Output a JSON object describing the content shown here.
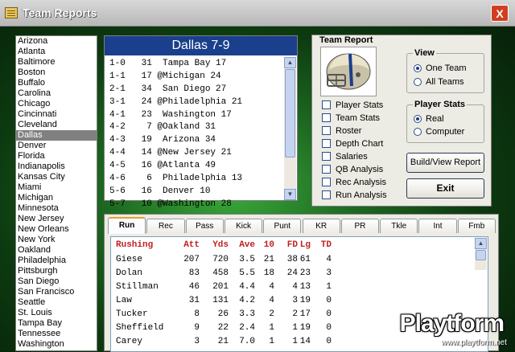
{
  "window": {
    "title": "Team Reports",
    "close_label": "X"
  },
  "teams": [
    "Arizona",
    "Atlanta",
    "Baltimore",
    "Boston",
    "Buffalo",
    "Carolina",
    "Chicago",
    "Cincinnati",
    "Cleveland",
    "Dallas",
    "Denver",
    "Florida",
    "Indianapolis",
    "Kansas City",
    "Miami",
    "Michigan",
    "Minnesota",
    "New Jersey",
    "New Orleans",
    "New York",
    "Oakland",
    "Philadelphia",
    "Pittsburgh",
    "San Diego",
    "San Francisco",
    "Seattle",
    "St. Louis",
    "Tampa Bay",
    "Tennessee",
    "Washington"
  ],
  "selected_team": "Dallas",
  "schedule": {
    "header": "Dallas 7-9",
    "games": [
      "1-0   31  Tampa Bay 17",
      "1-1   17 @Michigan 24",
      "2-1   34  San Diego 27",
      "3-1   24 @Philadelphia 21",
      "4-1   23  Washington 17",
      "4-2    7 @Oakland 31",
      "4-3   19  Arizona 34",
      "4-4   14 @New Jersey 21",
      "4-5   16 @Atlanta 49",
      "4-6    6  Philadelphia 13",
      "5-6   16  Denver 10",
      "5-7   10 @Washington 28"
    ]
  },
  "report": {
    "title": "Team Report",
    "checkboxes": [
      "Player Stats",
      "Team Stats",
      "Roster",
      "Depth Chart",
      "Salaries",
      "QB Analysis",
      "Rec Analysis",
      "Run Analysis"
    ],
    "view": {
      "label": "View",
      "options": [
        "One Team",
        "All Teams"
      ],
      "selected": "One Team"
    },
    "player_stats": {
      "label": "Player Stats",
      "options": [
        "Real",
        "Computer"
      ],
      "selected": "Real"
    },
    "build_button": "Build/View Report",
    "exit_button": "Exit"
  },
  "stats": {
    "tabs": [
      "Run",
      "Rec",
      "Pass",
      "Kick",
      "Punt",
      "KR",
      "PR",
      "Tkle",
      "Int",
      "Fmb"
    ],
    "active_tab": "Run",
    "columns": [
      "Rushing",
      "Att",
      "Yds",
      "Ave",
      "10",
      "FD",
      "Lg",
      "TD"
    ],
    "rows": [
      [
        "Giese",
        "207",
        "720",
        "3.5",
        "21",
        "38",
        "61",
        "4"
      ],
      [
        "Dolan",
        "83",
        "458",
        "5.5",
        "18",
        "24",
        "23",
        "3"
      ],
      [
        "Stillman",
        "46",
        "201",
        "4.4",
        "4",
        "4",
        "13",
        "1"
      ],
      [
        "Law",
        "31",
        "131",
        "4.2",
        "4",
        "3",
        "19",
        "0"
      ],
      [
        "Tucker",
        "8",
        "26",
        "3.3",
        "2",
        "2",
        "17",
        "0"
      ],
      [
        "Sheffield",
        "9",
        "22",
        "2.4",
        "1",
        "1",
        "19",
        "0"
      ],
      [
        "Carey",
        "3",
        "21",
        "7.0",
        "1",
        "1",
        "14",
        "0"
      ]
    ]
  },
  "watermark": {
    "brand": "Playtform",
    "url": "www.playtform.net"
  },
  "colors": {
    "header_blue": "#1a3f8c",
    "stats_header_red": "#c02020",
    "selection_gray": "#808080",
    "background_green": "#1f6a22"
  }
}
